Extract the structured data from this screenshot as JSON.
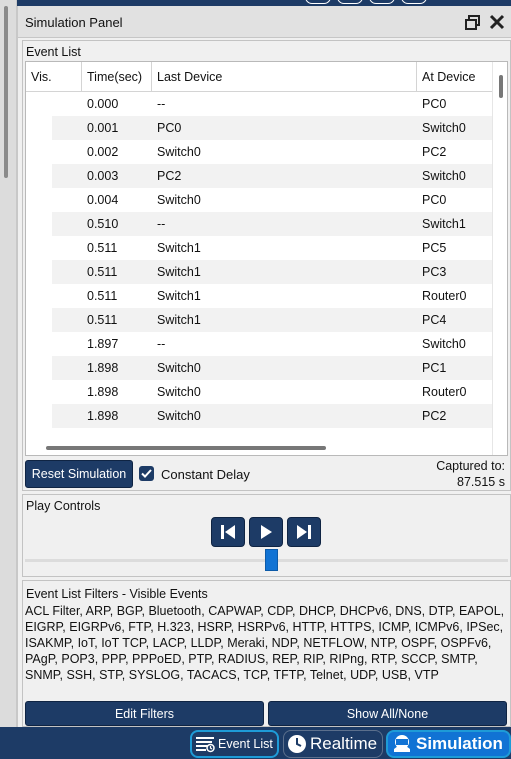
{
  "panel": {
    "title": "Simulation Panel"
  },
  "event_list": {
    "title": "Event List",
    "columns": [
      "Vis.",
      "Time(sec)",
      "Last Device",
      "At Device"
    ],
    "rows": [
      {
        "time": "0.000",
        "last": "--",
        "at": "PC0"
      },
      {
        "time": "0.001",
        "last": "PC0",
        "at": "Switch0"
      },
      {
        "time": "0.002",
        "last": "Switch0",
        "at": "PC2"
      },
      {
        "time": "0.003",
        "last": "PC2",
        "at": "Switch0"
      },
      {
        "time": "0.004",
        "last": "Switch0",
        "at": "PC0"
      },
      {
        "time": "0.510",
        "last": "--",
        "at": "Switch1"
      },
      {
        "time": "0.511",
        "last": "Switch1",
        "at": "PC5"
      },
      {
        "time": "0.511",
        "last": "Switch1",
        "at": "PC3"
      },
      {
        "time": "0.511",
        "last": "Switch1",
        "at": "Router0"
      },
      {
        "time": "0.511",
        "last": "Switch1",
        "at": "PC4"
      },
      {
        "time": "1.897",
        "last": "--",
        "at": "Switch0"
      },
      {
        "time": "1.898",
        "last": "Switch0",
        "at": "PC1"
      },
      {
        "time": "1.898",
        "last": "Switch0",
        "at": "Router0"
      },
      {
        "time": "1.898",
        "last": "Switch0",
        "at": "PC2"
      }
    ],
    "reset_label": "Reset Simulation",
    "constant_delay_label": "Constant Delay",
    "constant_delay_checked": true,
    "captured_label": "Captured to:",
    "captured_value": "87.515 s"
  },
  "play_controls": {
    "title": "Play Controls",
    "buttons": [
      "back-icon",
      "play-icon",
      "forward-icon"
    ]
  },
  "filters": {
    "title": "Event List Filters - Visible Events",
    "text": "ACL Filter, ARP, BGP, Bluetooth, CAPWAP, CDP, DHCP, DHCPv6, DNS, DTP, EAPOL, EIGRP, EIGRPv6, FTP, H.323, HSRP, HSRPv6, HTTP, HTTPS, ICMP, ICMPv6, IPSec, ISAKMP, IoT, IoT TCP, LACP, LLDP, Meraki, NDP, NETFLOW, NTP, OSPF, OSPFv6, PAgP, POP3, PPP, PPPoED, PTP, RADIUS, REP, RIP, RIPng, RTP, SCCP, SMTP, SNMP, SSH, STP, SYSLOG, TACACS, TCP, TFTP, Telnet, UDP, USB, VTP",
    "edit_label": "Edit Filters",
    "show_all_label": "Show All/None"
  },
  "bottom_bar": {
    "event_list_label": "Event List",
    "realtime_label": "Realtime",
    "simulation_label": "Simulation"
  },
  "colors": {
    "button_navy": "#1d3b66",
    "accent_blue": "#1173d4",
    "tab_border": "#1e9bd7"
  }
}
